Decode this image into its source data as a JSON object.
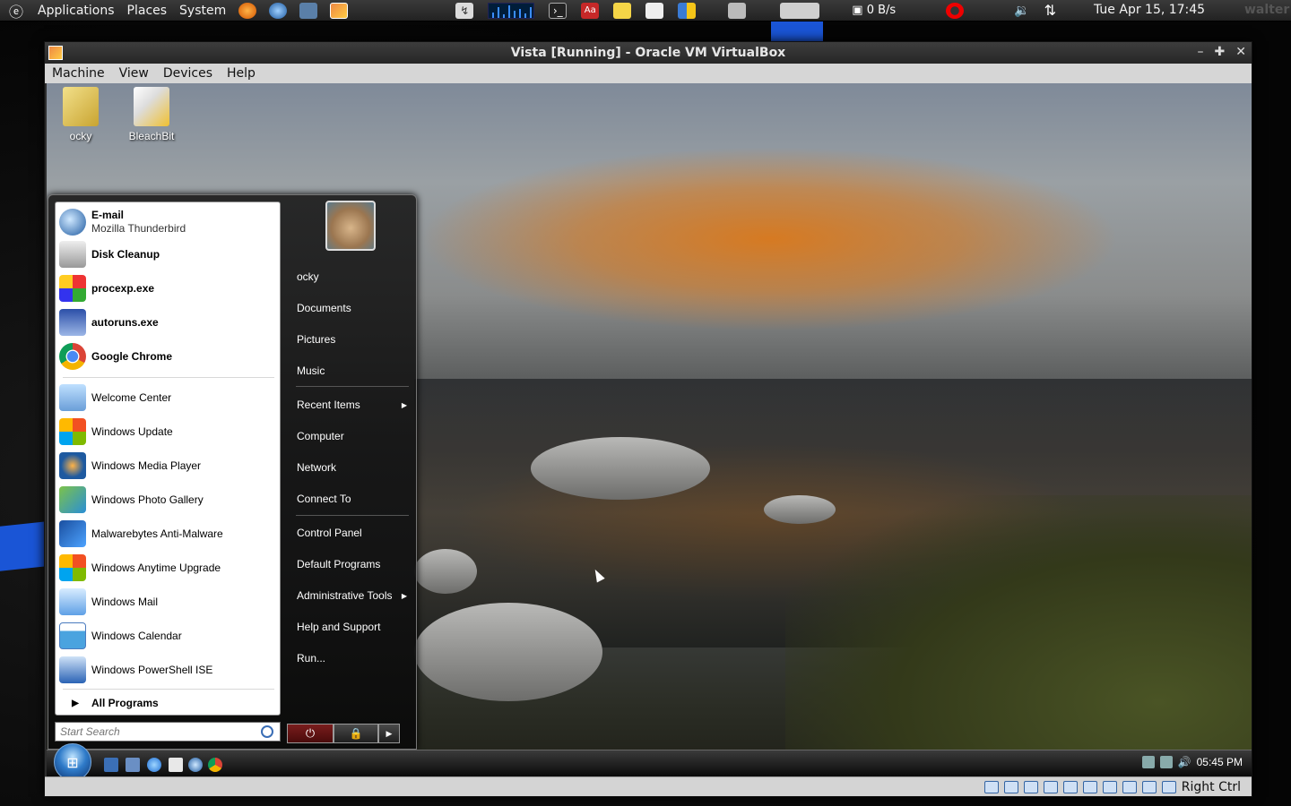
{
  "host_panel": {
    "menus": [
      "Applications",
      "Places",
      "System"
    ],
    "net_speed": "0 B/s",
    "clock": "Tue Apr 15, 17:45",
    "user": "walter"
  },
  "vbox": {
    "title": "Vista [Running] - Oracle VM VirtualBox",
    "menu": [
      "Machine",
      "View",
      "Devices",
      "Help"
    ],
    "host_key": "Right Ctrl"
  },
  "desktop_icons": [
    {
      "label": "ocky",
      "icon": "folder-icon"
    },
    {
      "label": "BleachBit",
      "icon": "bleachbit-icon"
    }
  ],
  "start_menu": {
    "pinned": [
      {
        "label": "E-mail",
        "sub": "Mozilla Thunderbird",
        "icon": "thunderbird-icon"
      },
      {
        "label": "Disk Cleanup",
        "icon": "disk-cleanup-icon"
      },
      {
        "label": "procexp.exe",
        "icon": "procexp-icon"
      },
      {
        "label": "autoruns.exe",
        "icon": "autoruns-icon"
      },
      {
        "label": "Google Chrome",
        "icon": "chrome-icon"
      }
    ],
    "recent": [
      {
        "label": "Welcome Center",
        "icon": "welcome-center-icon"
      },
      {
        "label": "Windows Update",
        "icon": "windows-update-icon"
      },
      {
        "label": "Windows Media Player",
        "icon": "media-player-icon"
      },
      {
        "label": "Windows Photo Gallery",
        "icon": "photo-gallery-icon"
      },
      {
        "label": "Malwarebytes Anti-Malware",
        "icon": "malwarebytes-icon"
      },
      {
        "label": "Windows Anytime Upgrade",
        "icon": "windows-logo-icon"
      },
      {
        "label": "Windows Mail",
        "icon": "windows-mail-icon"
      },
      {
        "label": "Windows Calendar",
        "icon": "calendar-icon"
      },
      {
        "label": "Windows PowerShell ISE",
        "icon": "powershell-icon"
      }
    ],
    "all_programs": "All Programs",
    "search_placeholder": "Start Search",
    "right": {
      "user": "ocky",
      "group1": [
        "Documents",
        "Pictures",
        "Music"
      ],
      "group2": [
        "Recent Items",
        "Computer",
        "Network",
        "Connect To"
      ],
      "group3": [
        "Control Panel",
        "Default Programs",
        "Administrative Tools",
        "Help and Support",
        "Run..."
      ]
    }
  },
  "vista_taskbar": {
    "time": "05:45 PM"
  },
  "colors": {
    "vista_accent": "#2f7bc9",
    "power_red": "#7a1d1d",
    "host_blue": "#1a55d6"
  }
}
